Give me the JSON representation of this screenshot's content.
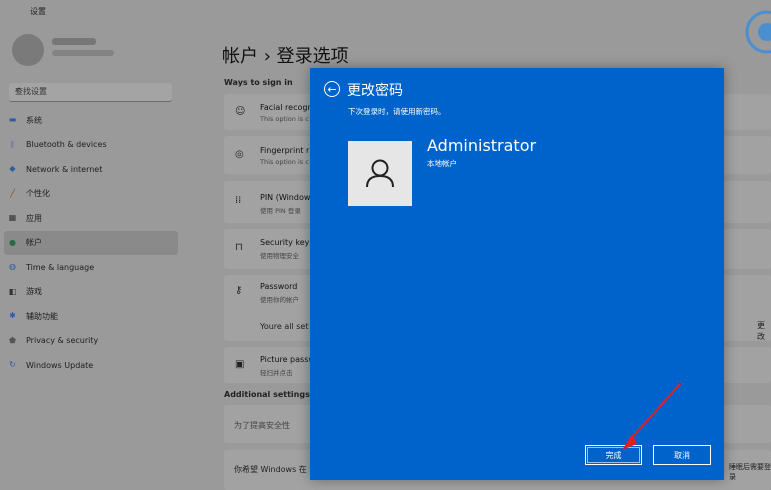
{
  "window": {
    "title": "设置"
  },
  "sidebar": {
    "search_placeholder": "查找设置",
    "items": [
      {
        "label": "系统",
        "icon": "monitor-icon",
        "active": false
      },
      {
        "label": "Bluetooth & devices",
        "icon": "bluetooth-icon",
        "active": false
      },
      {
        "label": "Network & internet",
        "icon": "network-icon",
        "active": false
      },
      {
        "label": "个性化",
        "icon": "brush-icon",
        "active": false
      },
      {
        "label": "应用",
        "icon": "apps-icon",
        "active": false
      },
      {
        "label": "帐户",
        "icon": "person-icon",
        "active": true
      },
      {
        "label": "Time & language",
        "icon": "globe-icon",
        "active": false
      },
      {
        "label": "游戏",
        "icon": "gamepad-icon",
        "active": false
      },
      {
        "label": "辅助功能",
        "icon": "accessibility-icon",
        "active": false
      },
      {
        "label": "Privacy & security",
        "icon": "shield-icon",
        "active": false
      },
      {
        "label": "Windows Update",
        "icon": "update-icon",
        "active": false
      }
    ]
  },
  "main": {
    "breadcrumb_parent": "帐户",
    "breadcrumb_sep": "›",
    "breadcrumb_current": "登录选项",
    "section_ways": "Ways to sign in",
    "rows": [
      {
        "title": "Facial recogn",
        "subtitle": "This option is c",
        "icon": "face-icon"
      },
      {
        "title": "Fingerprint r",
        "subtitle": "This option is c",
        "icon": "fingerprint-icon"
      },
      {
        "title": "PIN (Window",
        "subtitle": "使用 PIN 登录",
        "icon": "pin-icon"
      },
      {
        "title": "Security key",
        "subtitle": "使用物理安全",
        "icon": "key-icon"
      },
      {
        "title": "Password",
        "subtitle": "使用你的帐户",
        "icon": "password-key-icon"
      },
      {
        "title": "Picture passw",
        "subtitle": "轻扫并点击",
        "icon": "picture-icon"
      }
    ],
    "password_status": "Youre all set",
    "password_action": "更改",
    "section_additional": "Additional settings",
    "additional_text": "为了提高安全性",
    "windows_question": "你希望 Windows 在",
    "windows_question_tail": "睡眠后需要登录"
  },
  "dialog": {
    "title": "更改密码",
    "subtitle": "下次登录时，请使用新密码。",
    "account_name": "Administrator",
    "account_type": "本地帐户",
    "next_label": "完成",
    "cancel_label": "取消"
  },
  "colors": {
    "dialog_bg": "#0063cc",
    "annotation_arrow": "#e02020"
  }
}
